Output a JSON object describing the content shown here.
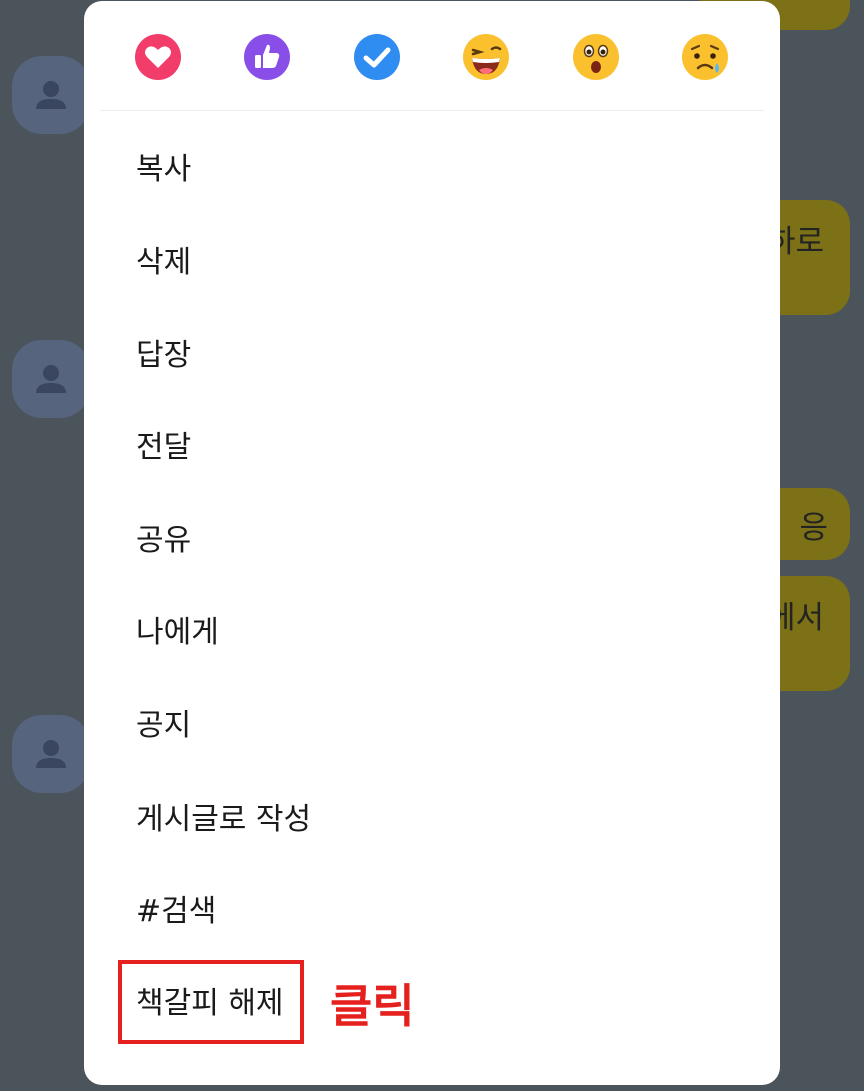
{
  "background": {
    "bubbles": [
      {
        "text": ""
      },
      {
        "text": "하로"
      },
      {
        "text": "응"
      },
      {
        "text": "에서"
      }
    ]
  },
  "reactions": [
    {
      "icon": "heart-icon",
      "color": "#f23d6b"
    },
    {
      "icon": "thumbs-up-icon",
      "color": "#8a4ee8"
    },
    {
      "icon": "check-icon",
      "color": "#2f8cf0"
    },
    {
      "icon": "laughing-emoji-icon",
      "color": "#fbc02d"
    },
    {
      "icon": "surprised-emoji-icon",
      "color": "#fbc02d"
    },
    {
      "icon": "sad-emoji-icon",
      "color": "#fbc02d"
    }
  ],
  "menu": {
    "items": [
      "복사",
      "삭제",
      "답장",
      "전달",
      "공유",
      "나에게",
      "공지",
      "게시글로 작성",
      "#검색",
      "책갈피 해제"
    ]
  },
  "annotation": {
    "label": "클릭",
    "color": "#e5211f"
  }
}
